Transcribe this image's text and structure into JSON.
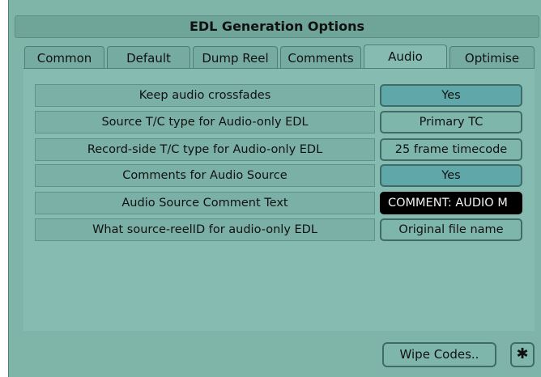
{
  "dialog": {
    "title": "EDL Generation Options"
  },
  "tabs": [
    {
      "label": "Common"
    },
    {
      "label": "Default"
    },
    {
      "label": "Dump Reel"
    },
    {
      "label": "Comments"
    },
    {
      "label": "Audio"
    },
    {
      "label": "Optimise"
    }
  ],
  "active_tab": "Audio",
  "options": [
    {
      "label": "Keep audio crossfades",
      "value": "Yes"
    },
    {
      "label": "Source T/C type for Audio-only EDL",
      "value": "Primary TC"
    },
    {
      "label": "Record-side T/C type for Audio-only EDL",
      "value": "25 frame timecode"
    },
    {
      "label": "Comments for Audio Source",
      "value": "Yes"
    },
    {
      "label": "Audio Source Comment Text",
      "value": "COMMENT: AUDIO M"
    },
    {
      "label": "What source-reelID for audio-only EDL",
      "value": "Original file name"
    }
  ],
  "footer": {
    "wipe_codes_label": "Wipe Codes..",
    "asterisk_glyph": "✱"
  },
  "colors": {
    "background": "#7fb4a9",
    "panel": "#85bbb0",
    "value_teal": "#5fa7a8",
    "text_field": "#000000"
  }
}
